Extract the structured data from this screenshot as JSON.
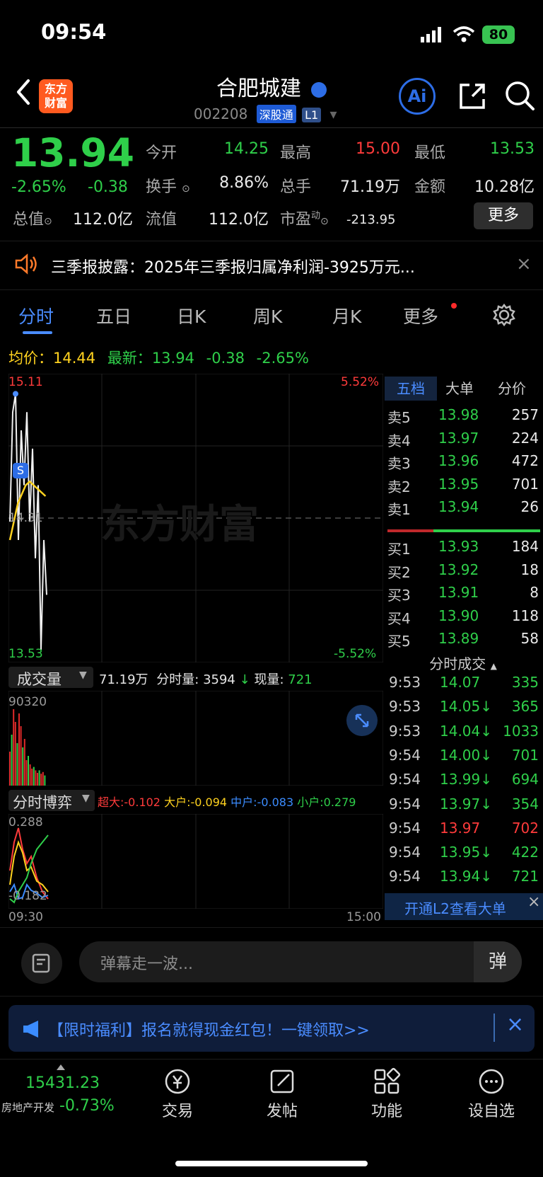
{
  "status": {
    "time": "09:54",
    "battery": "80"
  },
  "header": {
    "logo_line1": "东方",
    "logo_line2": "财富",
    "stock_name": "合肥城建",
    "stock_code": "002208",
    "tag_sgt": "深股通",
    "tag_l1": "L1"
  },
  "quote": {
    "price": "13.94",
    "change_pct": "-2.65%",
    "change": "-0.38",
    "open_label": "今开",
    "open": "14.25",
    "high_label": "最高",
    "high": "15.00",
    "low_label": "最低",
    "low": "13.53",
    "turnover_label": "换手",
    "turnover": "8.86%",
    "vol_label": "总手",
    "volume": "71.19万",
    "amt_label": "金额",
    "amount": "10.28亿",
    "mktcap_label": "总值",
    "mktcap": "112.0亿",
    "float_label": "流值",
    "float_cap": "112.0亿",
    "pe_label": "市盈",
    "pe_sup": "动",
    "pe": "-213.95",
    "more": "更多"
  },
  "news": {
    "text": "三季报披露：2025年三季报归属净利润-3925万元..."
  },
  "tabs": [
    {
      "label": "分时"
    },
    {
      "label": "五日"
    },
    {
      "label": "日K"
    },
    {
      "label": "周K"
    },
    {
      "label": "月K"
    },
    {
      "label": "更多"
    }
  ],
  "chart": {
    "avg_label": "均价：",
    "avg": "14.44",
    "latest_label": "最新：",
    "latest": "13.94",
    "latest_chg": "-0.38",
    "latest_pct": "-2.65%",
    "y_top": "15.11",
    "y_mid": "14.31",
    "y_bottom": "13.53",
    "pct_top": "5.52%",
    "pct_bottom": "-5.52%",
    "watermark": "东方财富",
    "vol_selector": "成交量",
    "vol_total": "71.19万",
    "vol_period_label": "分时量:",
    "vol_period": "3594",
    "vol_now_label": "现量:",
    "vol_now": "721",
    "vol_max": "90320",
    "game_selector": "分时博弈",
    "super_label": "超大:",
    "super": "-0.102",
    "big_label": "大户:",
    "big": "-0.094",
    "mid_label": "中户:",
    "mid": "-0.083",
    "small_label": "小户:",
    "small": "0.279",
    "game_top": "0.288",
    "game_bottom": "-0.182",
    "time_start": "09:30",
    "time_end": "15:00",
    "price_series": [
      14.3,
      14.9,
      15.0,
      14.2,
      14.8,
      14.5,
      14.9,
      14.3,
      14.7,
      14.1,
      14.5,
      13.6,
      14.2,
      13.9
    ],
    "avg_series": [
      14.2,
      14.3,
      14.4,
      14.45,
      14.5,
      14.52,
      14.5,
      14.48,
      14.46,
      14.44
    ],
    "volumes": [
      40,
      60,
      90,
      75,
      50,
      85,
      70,
      45,
      55,
      30,
      35,
      25,
      20,
      22,
      18,
      15,
      18,
      14,
      16,
      12
    ]
  },
  "orderbook": {
    "tabs": [
      "五档",
      "大单",
      "分价"
    ],
    "asks": [
      {
        "label": "卖5",
        "price": "13.98",
        "vol": "257"
      },
      {
        "label": "卖4",
        "price": "13.97",
        "vol": "224"
      },
      {
        "label": "卖3",
        "price": "13.96",
        "vol": "472"
      },
      {
        "label": "卖2",
        "price": "13.95",
        "vol": "701"
      },
      {
        "label": "卖1",
        "price": "13.94",
        "vol": "26"
      }
    ],
    "bids": [
      {
        "label": "买1",
        "price": "13.93",
        "vol": "184"
      },
      {
        "label": "买2",
        "price": "13.92",
        "vol": "18"
      },
      {
        "label": "买3",
        "price": "13.91",
        "vol": "8"
      },
      {
        "label": "买4",
        "price": "13.90",
        "vol": "118"
      },
      {
        "label": "买5",
        "price": "13.89",
        "vol": "58"
      }
    ],
    "trades_title": "分时成交",
    "trades": [
      {
        "time": "9:53",
        "price": "14.07",
        "vol": "335",
        "color": "green"
      },
      {
        "time": "9:53",
        "price": "14.05↓",
        "vol": "365",
        "color": "green"
      },
      {
        "time": "9:53",
        "price": "14.04↓",
        "vol": "1033",
        "color": "green"
      },
      {
        "time": "9:54",
        "price": "14.00↓",
        "vol": "701",
        "color": "green"
      },
      {
        "time": "9:54",
        "price": "13.99↓",
        "vol": "694",
        "color": "green"
      },
      {
        "time": "9:54",
        "price": "13.97↓",
        "vol": "354",
        "color": "green"
      },
      {
        "time": "9:54",
        "price": "13.97",
        "vol": "702",
        "color": "red"
      },
      {
        "time": "9:54",
        "price": "13.95↓",
        "vol": "422",
        "color": "green"
      },
      {
        "time": "9:54",
        "price": "13.94↓",
        "vol": "721",
        "color": "green"
      }
    ],
    "l2_promo": "开通L2查看大单"
  },
  "comment": {
    "placeholder": "弹幕走一波...",
    "danmu": "弹"
  },
  "banner": {
    "text": "【限时福利】报名就得现金红包！一键领取>>"
  },
  "bottom_nav": {
    "index_value": "15431.23",
    "index_name": "房地产开发",
    "index_pct": "-0.73%",
    "items": [
      {
        "label": "交易"
      },
      {
        "label": "发帖"
      },
      {
        "label": "功能"
      },
      {
        "label": "设自选"
      }
    ]
  }
}
